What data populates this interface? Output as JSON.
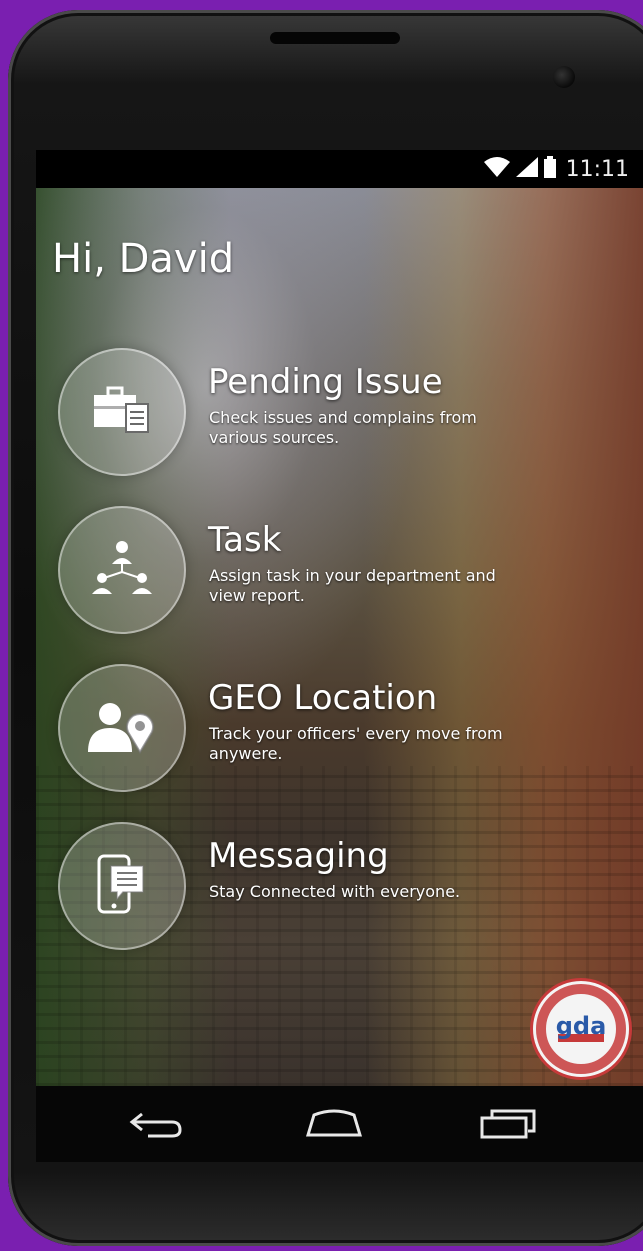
{
  "status": {
    "time": "11:11",
    "icons": [
      "wifi-icon",
      "signal-icon",
      "battery-icon"
    ]
  },
  "greeting": "Hi, David",
  "menu": [
    {
      "icon": "briefcase-document-icon",
      "title": "Pending Issue",
      "description": "Check issues and complains from various sources."
    },
    {
      "icon": "team-hierarchy-icon",
      "title": "Task",
      "description": "Assign task in your department and view report."
    },
    {
      "icon": "user-location-icon",
      "title": "GEO Location",
      "description": "Track your officers' every move from anywere."
    },
    {
      "icon": "phone-message-icon",
      "title": "Messaging",
      "description": "Stay Connected with everyone."
    }
  ],
  "logo": {
    "icon": "gda-seal-icon",
    "text": "gda"
  },
  "navigation": [
    "back-icon",
    "home-icon",
    "recent-apps-icon"
  ],
  "colors": {
    "background": "#7a1fb0",
    "text": "#ffffff",
    "logo_ring": "#c63a3a",
    "logo_text": "#2a5aa8"
  }
}
